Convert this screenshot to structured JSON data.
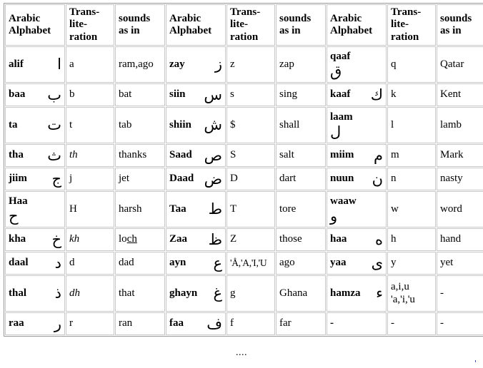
{
  "table": {
    "headers": {
      "alphabet": "Arabic\nAlphabet",
      "transliteration": "Trans-\nlite-\nration",
      "sounds": "sounds\nas in"
    },
    "groups": [
      {
        "group_name": "left-group",
        "rows": [
          {
            "name": "alif",
            "glyph": "ا",
            "translit": "a",
            "italic": false,
            "sound": "ram,ago",
            "height": "tall"
          },
          {
            "name": "baa",
            "glyph": "ب",
            "translit": "b",
            "italic": false,
            "sound": "bat",
            "height": "short"
          },
          {
            "name": "ta",
            "glyph": "ت",
            "translit": "t",
            "italic": false,
            "sound": "tab",
            "height": "tall"
          },
          {
            "name": "tha",
            "glyph": "ث",
            "translit": "th",
            "italic": true,
            "sound": "thanks",
            "height": "short"
          },
          {
            "name": "jiim",
            "glyph": "ج",
            "translit": "j",
            "italic": false,
            "sound": "jet",
            "height": "short"
          },
          {
            "name": "Haa",
            "glyph": "ح",
            "translit": "H",
            "italic": false,
            "sound": "harsh",
            "height": "tall",
            "stacked": true
          },
          {
            "name": "kha",
            "glyph": "خ",
            "translit": "kh",
            "italic": true,
            "sound": "loch",
            "sound_underline": "ch",
            "height": "short"
          },
          {
            "name": "daal",
            "glyph": "د",
            "translit": "d",
            "italic": false,
            "sound": "dad",
            "height": "short"
          },
          {
            "name": "thal",
            "glyph": "ذ",
            "translit": "dh",
            "italic": true,
            "sound": "that",
            "height": "tall"
          },
          {
            "name": "raa",
            "glyph": "ر",
            "translit": "r",
            "italic": false,
            "sound": "ran",
            "height": "short"
          }
        ]
      },
      {
        "group_name": "middle-group",
        "rows": [
          {
            "name": "zay",
            "glyph": "ز",
            "translit": "z",
            "italic": false,
            "sound": "zap",
            "height": "tall"
          },
          {
            "name": "siin",
            "glyph": "س",
            "translit": "s",
            "italic": false,
            "sound": "sing",
            "height": "short"
          },
          {
            "name": "shiin",
            "glyph": "ش",
            "translit": "$",
            "italic": false,
            "sound": "shall",
            "height": "tall"
          },
          {
            "name": "Saad",
            "glyph": "ص",
            "translit": "S",
            "italic": false,
            "sound": "salt",
            "height": "short"
          },
          {
            "name": "Daad",
            "glyph": "ض",
            "translit": "D",
            "italic": false,
            "sound": "dart",
            "height": "short"
          },
          {
            "name": "Taa",
            "glyph": "ط",
            "translit": "T",
            "italic": false,
            "sound": "tore",
            "height": "tall"
          },
          {
            "name": "Zaa",
            "glyph": "ظ",
            "translit": "Z",
            "italic": false,
            "sound": "those",
            "height": "short"
          },
          {
            "name": "ayn",
            "glyph": "ع",
            "translit": "'Å,'A,'I,'U",
            "italic": false,
            "sound": "ago",
            "height": "short",
            "narrow": true
          },
          {
            "name": "ghayn",
            "glyph": "غ",
            "translit": "g",
            "italic": false,
            "sound": "Ghana",
            "height": "tall"
          },
          {
            "name": "faa",
            "glyph": "ف",
            "translit": "f",
            "italic": false,
            "sound": "far",
            "height": "short"
          }
        ]
      },
      {
        "group_name": "right-group",
        "rows": [
          {
            "name": "qaaf",
            "glyph": "ق",
            "translit": "q",
            "italic": false,
            "sound": "Qatar",
            "height": "tall",
            "stacked": true
          },
          {
            "name": "kaaf",
            "glyph": "ك",
            "translit": "k",
            "italic": false,
            "sound": "Kent",
            "height": "short"
          },
          {
            "name": "laam",
            "glyph": "ل",
            "translit": "l",
            "italic": false,
            "sound": "lamb",
            "height": "tall",
            "stacked": true
          },
          {
            "name": "miim",
            "glyph": "م",
            "translit": "m",
            "italic": false,
            "sound": "Mark",
            "height": "short"
          },
          {
            "name": "nuun",
            "glyph": "ن",
            "translit": "n",
            "italic": false,
            "sound": "nasty",
            "height": "short"
          },
          {
            "name": "waaw",
            "glyph": "و",
            "translit": "w",
            "italic": false,
            "sound": "word",
            "height": "tall",
            "stacked": true
          },
          {
            "name": "haa",
            "glyph": "ه",
            "translit": "h",
            "italic": false,
            "sound": "hand",
            "height": "short"
          },
          {
            "name": "yaa",
            "glyph": "ى",
            "translit": "y",
            "italic": false,
            "sound": "yet",
            "height": "short"
          },
          {
            "name": "hamza",
            "glyph": "ء",
            "translit": "a,i,u",
            "translit_line2": "'a,'i,'u",
            "italic": false,
            "sound": "-",
            "height": "tall"
          },
          {
            "name": "-",
            "glyph": "",
            "translit": "-",
            "italic": false,
            "sound": "-",
            "height": "short"
          }
        ]
      }
    ]
  },
  "footer": {
    "ellipsis": "....",
    "corner_mark": "'",
    "corner_color": "#2b3ea8"
  }
}
